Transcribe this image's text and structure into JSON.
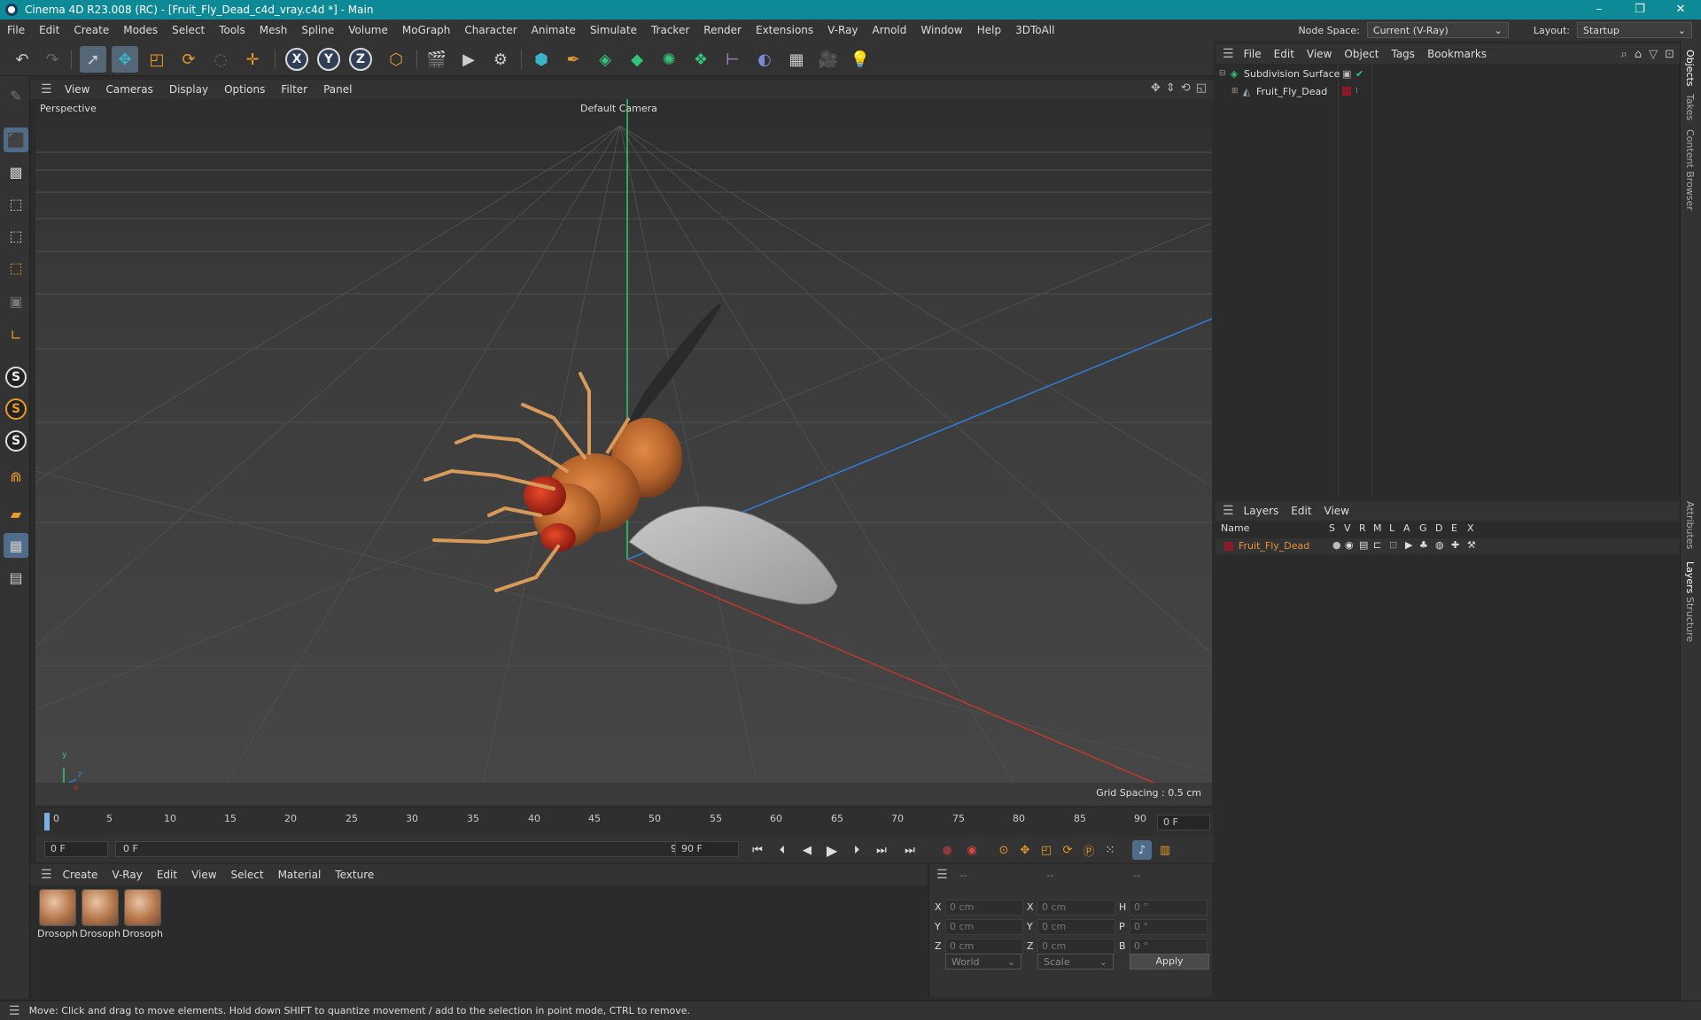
{
  "window": {
    "title": "Cinema 4D R23.008 (RC) - [Fruit_Fly_Dead_c4d_vray.c4d *] - Main",
    "controls": [
      "–",
      "❐",
      "✕"
    ]
  },
  "menubar": {
    "items": [
      "File",
      "Edit",
      "Create",
      "Modes",
      "Select",
      "Tools",
      "Mesh",
      "Spline",
      "Volume",
      "MoGraph",
      "Character",
      "Animate",
      "Simulate",
      "Tracker",
      "Render",
      "Extensions",
      "V-Ray",
      "Arnold",
      "Window",
      "Help",
      "3DToAll"
    ],
    "node_space_label": "Node Space:",
    "node_space_value": "Current (V-Ray)",
    "layout_label": "Layout:",
    "layout_value": "Startup"
  },
  "toolbar": {
    "axis_x": "X",
    "axis_y": "Y",
    "axis_z": "Z"
  },
  "left_tools": {
    "s1": "S",
    "s2": "S",
    "s3": "S"
  },
  "viewport": {
    "menu": [
      "View",
      "Cameras",
      "Display",
      "Options",
      "Filter",
      "Panel"
    ],
    "view_name": "Perspective",
    "camera": "Default Camera",
    "grid_spacing": "Grid Spacing : 0.5 cm",
    "axis_labels": {
      "y": "y",
      "z": "z",
      "x": "x"
    }
  },
  "timeline": {
    "ticks": [
      "0",
      "5",
      "10",
      "15",
      "20",
      "25",
      "30",
      "35",
      "40",
      "45",
      "50",
      "55",
      "60",
      "65",
      "70",
      "75",
      "80",
      "85",
      "90"
    ],
    "current_frame": "0 F"
  },
  "transport": {
    "start_field": "0 F",
    "range_start": "0 F",
    "range_end": "90 F",
    "end_field": "90 F"
  },
  "materials": {
    "menu": [
      "Create",
      "V-Ray",
      "Edit",
      "View",
      "Select",
      "Material",
      "Texture"
    ],
    "items": [
      "Drosoph",
      "Drosoph",
      "Drosoph"
    ]
  },
  "coordinates": {
    "header": [
      "--",
      "--",
      "--"
    ],
    "rows": [
      {
        "a1": "X",
        "v1": "0 cm",
        "a2": "X",
        "v2": "0 cm",
        "a3": "H",
        "v3": "0 °"
      },
      {
        "a1": "Y",
        "v1": "0 cm",
        "a2": "Y",
        "v2": "0 cm",
        "a3": "P",
        "v3": "0 °"
      },
      {
        "a1": "Z",
        "v1": "0 cm",
        "a2": "Z",
        "v2": "0 cm",
        "a3": "B",
        "v3": "0 °"
      }
    ],
    "mode_world": "World",
    "mode_scale": "Scale",
    "apply": "Apply"
  },
  "status": {
    "text": "Move: Click and drag to move elements. Hold down SHIFT to quantize movement / add to the selection in point mode, CTRL to remove."
  },
  "object_manager": {
    "menu": [
      "File",
      "Edit",
      "View",
      "Object",
      "Tags",
      "Bookmarks"
    ],
    "objects": [
      {
        "name": "Subdivision Surface"
      },
      {
        "name": "Fruit_Fly_Dead"
      }
    ]
  },
  "layer_manager": {
    "menu": [
      "Layers",
      "Edit",
      "View"
    ],
    "columns": [
      "Name",
      "S",
      "V",
      "R",
      "M",
      "L",
      "A",
      "G",
      "D",
      "E",
      "X"
    ],
    "rows": [
      {
        "name": "Fruit_Fly_Dead",
        "color": "#8b1a2a"
      }
    ]
  },
  "side_tabs": [
    "Objects",
    "Takes",
    "Content Browser",
    "Attributes",
    "Layers",
    "Structure"
  ],
  "colors": {
    "titlebar": "#0d8a96",
    "x_axis": "#c0392b",
    "y_axis": "#2ecc71",
    "z_axis": "#2f7fd6",
    "selected_layer_text": "#e8923a"
  }
}
